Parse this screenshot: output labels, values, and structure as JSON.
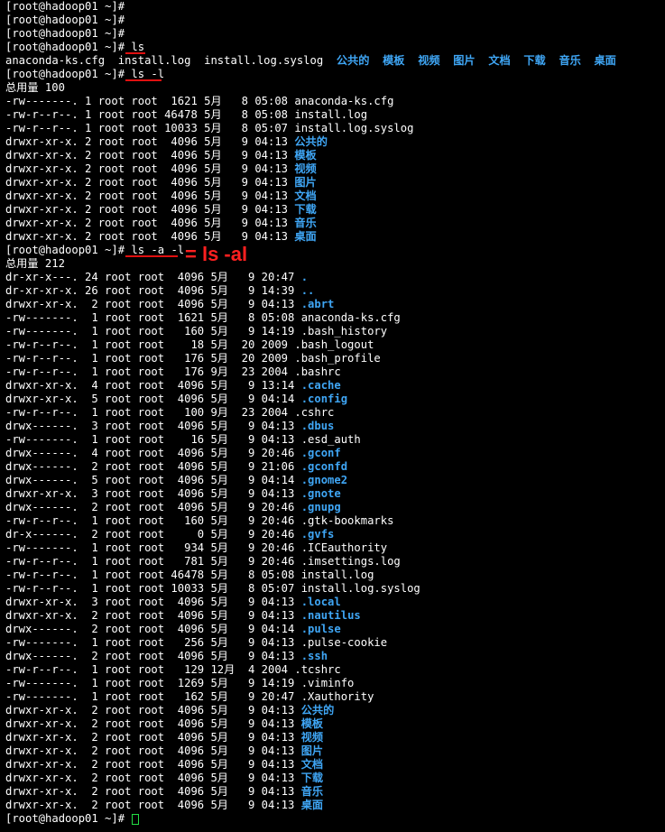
{
  "prompt": "[root@hadoop01 ~]# ",
  "lines": [
    {
      "segs": [
        {
          "t": "[root@hadoop01 ~]#"
        }
      ]
    },
    {
      "segs": [
        {
          "t": "[root@hadoop01 ~]#"
        }
      ]
    },
    {
      "segs": [
        {
          "t": "[root@hadoop01 ~]#"
        }
      ]
    },
    {
      "segs": [
        {
          "t": "[root@hadoop01 ~]# "
        },
        {
          "t": "ls",
          "k": "cmd"
        }
      ]
    },
    {
      "segs": [
        {
          "t": "anaconda-ks.cfg  install.log  install.log.syslog  "
        },
        {
          "t": "公共的",
          "k": "dir"
        },
        {
          "t": "  "
        },
        {
          "t": "模板",
          "k": "dir"
        },
        {
          "t": "  "
        },
        {
          "t": "视频",
          "k": "dir"
        },
        {
          "t": "  "
        },
        {
          "t": "图片",
          "k": "dir"
        },
        {
          "t": "  "
        },
        {
          "t": "文档",
          "k": "dir"
        },
        {
          "t": "  "
        },
        {
          "t": "下载",
          "k": "dir"
        },
        {
          "t": "  "
        },
        {
          "t": "音乐",
          "k": "dir"
        },
        {
          "t": "  "
        },
        {
          "t": "桌面",
          "k": "dir"
        }
      ]
    },
    {
      "segs": [
        {
          "t": "[root@hadoop01 ~]# "
        },
        {
          "t": "ls -l",
          "k": "cmd"
        }
      ]
    },
    {
      "segs": [
        {
          "t": "总用量 100"
        }
      ]
    },
    {
      "segs": [
        {
          "t": "-rw-------. 1 root root  1621 5月   8 05:08 anaconda-ks.cfg"
        }
      ]
    },
    {
      "segs": [
        {
          "t": "-rw-r--r--. 1 root root 46478 5月   8 05:08 install.log"
        }
      ]
    },
    {
      "segs": [
        {
          "t": "-rw-r--r--. 1 root root 10033 5月   8 05:07 install.log.syslog"
        }
      ]
    },
    {
      "segs": [
        {
          "t": "drwxr-xr-x. 2 root root  4096 5月   9 04:13 "
        },
        {
          "t": "公共的",
          "k": "dir"
        }
      ]
    },
    {
      "segs": [
        {
          "t": "drwxr-xr-x. 2 root root  4096 5月   9 04:13 "
        },
        {
          "t": "模板",
          "k": "dir"
        }
      ]
    },
    {
      "segs": [
        {
          "t": "drwxr-xr-x. 2 root root  4096 5月   9 04:13 "
        },
        {
          "t": "视频",
          "k": "dir"
        }
      ]
    },
    {
      "segs": [
        {
          "t": "drwxr-xr-x. 2 root root  4096 5月   9 04:13 "
        },
        {
          "t": "图片",
          "k": "dir"
        }
      ]
    },
    {
      "segs": [
        {
          "t": "drwxr-xr-x. 2 root root  4096 5月   9 04:13 "
        },
        {
          "t": "文档",
          "k": "dir"
        }
      ]
    },
    {
      "segs": [
        {
          "t": "drwxr-xr-x. 2 root root  4096 5月   9 04:13 "
        },
        {
          "t": "下载",
          "k": "dir"
        }
      ]
    },
    {
      "segs": [
        {
          "t": "drwxr-xr-x. 2 root root  4096 5月   9 04:13 "
        },
        {
          "t": "音乐",
          "k": "dir"
        }
      ]
    },
    {
      "segs": [
        {
          "t": "drwxr-xr-x. 2 root root  4096 5月   9 04:13 "
        },
        {
          "t": "桌面",
          "k": "dir"
        }
      ]
    },
    {
      "segs": [
        {
          "t": "[root@hadoop01 ~]# "
        },
        {
          "t": "ls -a -l",
          "k": "cmd"
        }
      ]
    },
    {
      "segs": [
        {
          "t": "总用量 212"
        }
      ]
    },
    {
      "segs": [
        {
          "t": "dr-xr-x---. 24 root root  4096 5月   9 20:47 "
        },
        {
          "t": ".",
          "k": "dir"
        }
      ]
    },
    {
      "segs": [
        {
          "t": "dr-xr-xr-x. 26 root root  4096 5月   9 14:39 "
        },
        {
          "t": "..",
          "k": "dir"
        }
      ]
    },
    {
      "segs": [
        {
          "t": "drwxr-xr-x.  2 root root  4096 5月   9 04:13 "
        },
        {
          "t": ".abrt",
          "k": "dir"
        }
      ]
    },
    {
      "segs": [
        {
          "t": "-rw-------.  1 root root  1621 5月   8 05:08 anaconda-ks.cfg"
        }
      ]
    },
    {
      "segs": [
        {
          "t": "-rw-------.  1 root root   160 5月   9 14:19 .bash_history"
        }
      ]
    },
    {
      "segs": [
        {
          "t": "-rw-r--r--.  1 root root    18 5月  20 2009 .bash_logout"
        }
      ]
    },
    {
      "segs": [
        {
          "t": "-rw-r--r--.  1 root root   176 5月  20 2009 .bash_profile"
        }
      ]
    },
    {
      "segs": [
        {
          "t": "-rw-r--r--.  1 root root   176 9月  23 2004 .bashrc"
        }
      ]
    },
    {
      "segs": [
        {
          "t": "drwxr-xr-x.  4 root root  4096 5月   9 13:14 "
        },
        {
          "t": ".cache",
          "k": "dir"
        }
      ]
    },
    {
      "segs": [
        {
          "t": "drwxr-xr-x.  5 root root  4096 5月   9 04:14 "
        },
        {
          "t": ".config",
          "k": "dir"
        }
      ]
    },
    {
      "segs": [
        {
          "t": "-rw-r--r--.  1 root root   100 9月  23 2004 .cshrc"
        }
      ]
    },
    {
      "segs": [
        {
          "t": "drwx------.  3 root root  4096 5月   9 04:13 "
        },
        {
          "t": ".dbus",
          "k": "dir"
        }
      ]
    },
    {
      "segs": [
        {
          "t": "-rw-------.  1 root root    16 5月   9 04:13 .esd_auth"
        }
      ]
    },
    {
      "segs": [
        {
          "t": "drwx------.  4 root root  4096 5月   9 20:46 "
        },
        {
          "t": ".gconf",
          "k": "dir"
        }
      ]
    },
    {
      "segs": [
        {
          "t": "drwx------.  2 root root  4096 5月   9 21:06 "
        },
        {
          "t": ".gconfd",
          "k": "dir"
        }
      ]
    },
    {
      "segs": [
        {
          "t": "drwx------.  5 root root  4096 5月   9 04:14 "
        },
        {
          "t": ".gnome2",
          "k": "dir"
        }
      ]
    },
    {
      "segs": [
        {
          "t": "drwxr-xr-x.  3 root root  4096 5月   9 04:13 "
        },
        {
          "t": ".gnote",
          "k": "dir"
        }
      ]
    },
    {
      "segs": [
        {
          "t": "drwx------.  2 root root  4096 5月   9 20:46 "
        },
        {
          "t": ".gnupg",
          "k": "dir"
        }
      ]
    },
    {
      "segs": [
        {
          "t": "-rw-r--r--.  1 root root   160 5月   9 20:46 .gtk-bookmarks"
        }
      ]
    },
    {
      "segs": [
        {
          "t": "dr-x------.  2 root root     0 5月   9 20:46 "
        },
        {
          "t": ".gvfs",
          "k": "dir"
        }
      ]
    },
    {
      "segs": [
        {
          "t": "-rw-------.  1 root root   934 5月   9 20:46 .ICEauthority"
        }
      ]
    },
    {
      "segs": [
        {
          "t": "-rw-r--r--.  1 root root   781 5月   9 20:46 .imsettings.log"
        }
      ]
    },
    {
      "segs": [
        {
          "t": "-rw-r--r--.  1 root root 46478 5月   8 05:08 install.log"
        }
      ]
    },
    {
      "segs": [
        {
          "t": "-rw-r--r--.  1 root root 10033 5月   8 05:07 install.log.syslog"
        }
      ]
    },
    {
      "segs": [
        {
          "t": "drwxr-xr-x.  3 root root  4096 5月   9 04:13 "
        },
        {
          "t": ".local",
          "k": "dir"
        }
      ]
    },
    {
      "segs": [
        {
          "t": "drwxr-xr-x.  2 root root  4096 5月   9 04:13 "
        },
        {
          "t": ".nautilus",
          "k": "dir"
        }
      ]
    },
    {
      "segs": [
        {
          "t": "drwx------.  2 root root  4096 5月   9 04:14 "
        },
        {
          "t": ".pulse",
          "k": "dir"
        }
      ]
    },
    {
      "segs": [
        {
          "t": "-rw-------.  1 root root   256 5月   9 04:13 .pulse-cookie"
        }
      ]
    },
    {
      "segs": [
        {
          "t": "drwx------.  2 root root  4096 5月   9 04:13 "
        },
        {
          "t": ".ssh",
          "k": "dir"
        }
      ]
    },
    {
      "segs": [
        {
          "t": "-rw-r--r--.  1 root root   129 12月  4 2004 .tcshrc"
        }
      ]
    },
    {
      "segs": [
        {
          "t": "-rw-------.  1 root root  1269 5月   9 14:19 .viminfo"
        }
      ]
    },
    {
      "segs": [
        {
          "t": "-rw-------.  1 root root   162 5月   9 20:47 .Xauthority"
        }
      ]
    },
    {
      "segs": [
        {
          "t": "drwxr-xr-x.  2 root root  4096 5月   9 04:13 "
        },
        {
          "t": "公共的",
          "k": "dir"
        }
      ]
    },
    {
      "segs": [
        {
          "t": "drwxr-xr-x.  2 root root  4096 5月   9 04:13 "
        },
        {
          "t": "模板",
          "k": "dir"
        }
      ]
    },
    {
      "segs": [
        {
          "t": "drwxr-xr-x.  2 root root  4096 5月   9 04:13 "
        },
        {
          "t": "视频",
          "k": "dir"
        }
      ]
    },
    {
      "segs": [
        {
          "t": "drwxr-xr-x.  2 root root  4096 5月   9 04:13 "
        },
        {
          "t": "图片",
          "k": "dir"
        }
      ]
    },
    {
      "segs": [
        {
          "t": "drwxr-xr-x.  2 root root  4096 5月   9 04:13 "
        },
        {
          "t": "文档",
          "k": "dir"
        }
      ]
    },
    {
      "segs": [
        {
          "t": "drwxr-xr-x.  2 root root  4096 5月   9 04:13 "
        },
        {
          "t": "下载",
          "k": "dir"
        }
      ]
    },
    {
      "segs": [
        {
          "t": "drwxr-xr-x.  2 root root  4096 5月   9 04:13 "
        },
        {
          "t": "音乐",
          "k": "dir"
        }
      ]
    },
    {
      "segs": [
        {
          "t": "drwxr-xr-x.  2 root root  4096 5月   9 04:13 "
        },
        {
          "t": "桌面",
          "k": "dir"
        }
      ]
    },
    {
      "segs": [
        {
          "t": "[root@hadoop01 ~]# "
        }
      ],
      "cursor": true
    }
  ],
  "annotation": "= ls -al",
  "colors": {
    "background": "#000000",
    "text": "#ffffff",
    "directory": "#3fa6f5",
    "annotation": "#ff2020",
    "underline": "#e01010",
    "cursor": "#22dd44"
  }
}
